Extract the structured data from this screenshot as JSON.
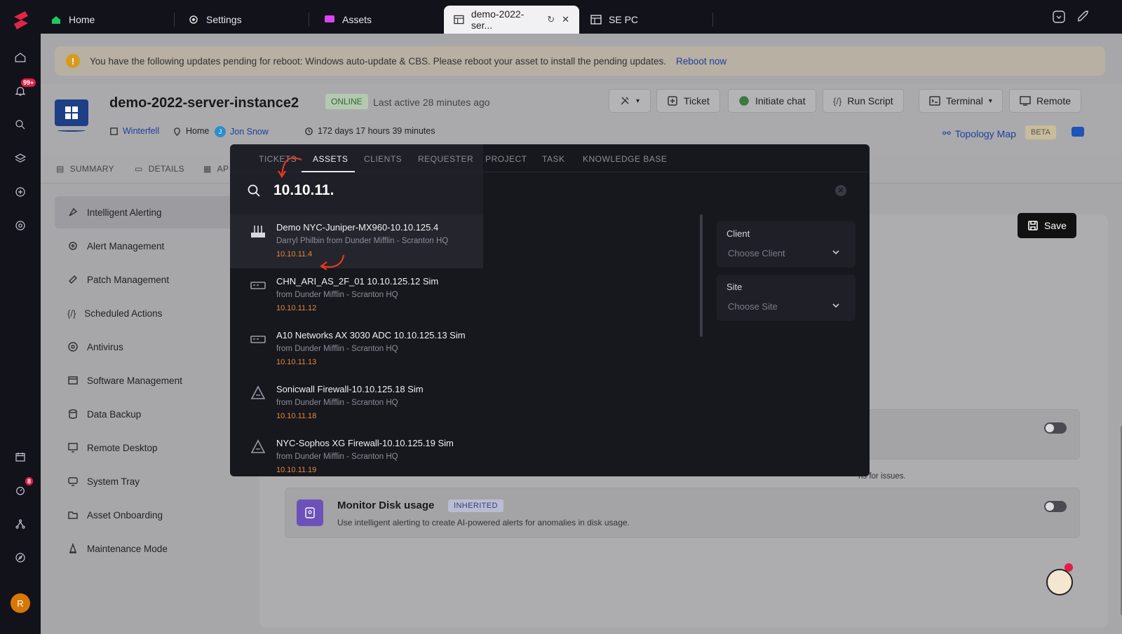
{
  "tabs": [
    {
      "label": "Home",
      "icon": "home-icon"
    },
    {
      "label": "Settings",
      "icon": "gear-icon"
    },
    {
      "label": "Assets",
      "icon": "assets-icon"
    },
    {
      "label": "demo-2022-ser...",
      "icon": "asset-window-icon"
    },
    {
      "label": "SE PC",
      "icon": "asset-window-icon"
    }
  ],
  "rail": {
    "notifications_badge": "99+",
    "timer_badge": "8",
    "avatar_initial": "R"
  },
  "banner": {
    "message": "You have the following updates pending for reboot: Windows auto-update & CBS. Please reboot your asset to install the pending updates.",
    "action": "Reboot now"
  },
  "asset": {
    "name": "demo-2022-server-instance2",
    "status": "ONLINE",
    "last_active": "Last active 28 minutes ago",
    "site": "Winterfell",
    "location": "Home",
    "user_initial": "J",
    "user": "Jon Snow",
    "uptime": "172 days 17 hours 39 minutes"
  },
  "actions": {
    "ticket": "Ticket",
    "chat": "Initiate chat",
    "run_script": "Run Script",
    "terminal": "Terminal",
    "remote": "Remote",
    "topology": "Topology Map",
    "beta": "BETA"
  },
  "subtabs": [
    "SUMMARY",
    "DETAILS",
    "AP"
  ],
  "sidemenu": [
    "Intelligent Alerting",
    "Alert Management",
    "Patch Management",
    "Scheduled Actions",
    "Antivirus",
    "Software Management",
    "Data Backup",
    "Remote Desktop",
    "System Tray",
    "Asset Onboarding",
    "Maintenance Mode"
  ],
  "content": {
    "save": "Save",
    "partial_desc": "ns for issues.",
    "disk_title": "Monitor Disk usage",
    "disk_badge": "INHERITED",
    "disk_desc": "Use intelligent alerting to create AI-powered alerts for anomalies in disk usage."
  },
  "search": {
    "tabs": [
      "TICKETS",
      "ASSETS",
      "CLIENTS",
      "REQUESTER",
      "PROJECT",
      "TASK",
      "KNOWLEDGE BASE"
    ],
    "active_tab": "ASSETS",
    "query": "10.10.11.",
    "results": [
      {
        "title": "Demo NYC-Juniper-MX960-10.10.125.4",
        "sub": "Darryl Philbin  from  Dunder Mifflin  - Scranton HQ",
        "ip": "10.10.11.4",
        "icon": "router-icon"
      },
      {
        "title": "CHN_ARI_AS_2F_01 10.10.125.12 Sim",
        "sub": "from  Dunder Mifflin  - Scranton HQ",
        "ip": "10.10.11.12",
        "icon": "switch-icon"
      },
      {
        "title": "A10 Networks AX 3030 ADC 10.10.125.13 Sim",
        "sub": "from  Dunder Mifflin  - Scranton HQ",
        "ip": "10.10.11.13",
        "icon": "switch-icon"
      },
      {
        "title": "Sonicwall Firewall-10.10.125.18 Sim",
        "sub": "from  Dunder Mifflin  - Scranton HQ",
        "ip": "10.10.11.18",
        "icon": "firewall-icon"
      },
      {
        "title": "NYC-Sophos XG Firewall-10.10.125.19 Sim",
        "sub": "from  Dunder Mifflin  - Scranton HQ",
        "ip": "10.10.11.19",
        "icon": "firewall-icon"
      }
    ],
    "filters": [
      {
        "label": "Client",
        "placeholder": "Choose Client"
      },
      {
        "label": "Site",
        "placeholder": "Choose Site"
      }
    ]
  }
}
